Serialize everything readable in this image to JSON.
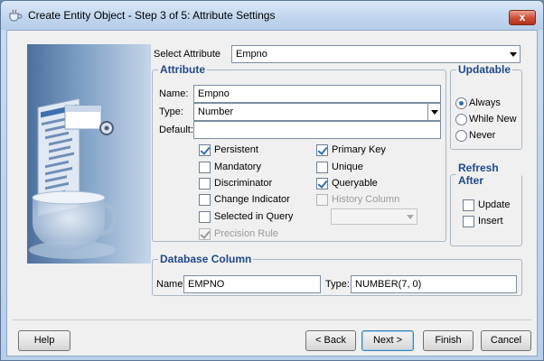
{
  "window": {
    "title": "Create Entity Object - Step 3 of 5: Attribute Settings",
    "close_label": "x"
  },
  "select_attribute": {
    "label": "Select Attribute",
    "value": "Empno"
  },
  "attribute": {
    "legend": "Attribute",
    "name_label": "Name:",
    "name_value": "Empno",
    "type_label": "Type:",
    "type_value": "Number",
    "default_label": "Default:",
    "default_value": ""
  },
  "checkboxes": {
    "persistent": {
      "label": "Persistent",
      "checked": true
    },
    "mandatory": {
      "label": "Mandatory",
      "checked": false
    },
    "discriminator": {
      "label": "Discriminator",
      "checked": false
    },
    "change_indicator": {
      "label": "Change Indicator",
      "checked": false
    },
    "selected_in_query": {
      "label": "Selected in Query",
      "checked": false
    },
    "precision_rule": {
      "label": "Precision Rule",
      "checked": true,
      "disabled": true
    },
    "primary_key": {
      "label": "Primary Key",
      "checked": true
    },
    "unique": {
      "label": "Unique",
      "checked": false
    },
    "queryable": {
      "label": "Queryable",
      "checked": true
    },
    "history_column": {
      "label": "History Column",
      "checked": false,
      "disabled": true
    }
  },
  "updatable": {
    "legend": "Updatable",
    "options": [
      "Always",
      "While New",
      "Never"
    ],
    "selected": "Always"
  },
  "refresh_after": {
    "legend": "Refresh After",
    "update_label": "Update",
    "insert_label": "Insert"
  },
  "database_column": {
    "legend": "Database Column",
    "name_label": "Name:",
    "name_value": "EMPNO",
    "type_label": "Type:",
    "type_value": "NUMBER(7, 0)"
  },
  "buttons": {
    "help": "Help",
    "back": "< Back",
    "next": "Next >",
    "finish": "Finish",
    "cancel": "Cancel"
  },
  "colors": {
    "legend_blue": "#1f4a8a",
    "check_blue": "#2f6fb1",
    "close_red": "#c9442c"
  }
}
